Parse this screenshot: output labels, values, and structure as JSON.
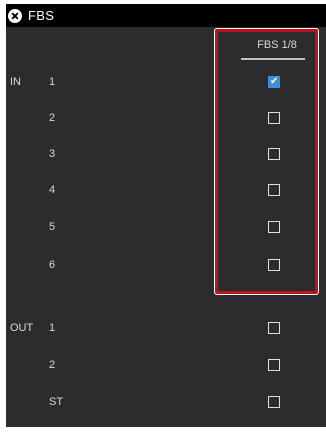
{
  "window": {
    "title": "FBS"
  },
  "column": {
    "header": "FBS 1/8"
  },
  "groups": {
    "in": "IN",
    "out": "OUT"
  },
  "rows": [
    {
      "group": "in",
      "label": "1",
      "checked": true
    },
    {
      "group": "in",
      "label": "2",
      "checked": false
    },
    {
      "group": "in",
      "label": "3",
      "checked": false
    },
    {
      "group": "in",
      "label": "4",
      "checked": false
    },
    {
      "group": "in",
      "label": "5",
      "checked": false
    },
    {
      "group": "in",
      "label": "6",
      "checked": false
    },
    {
      "group": "out",
      "label": "1",
      "checked": false
    },
    {
      "group": "out",
      "label": "2",
      "checked": false
    },
    {
      "group": "out",
      "label": "ST",
      "checked": false
    }
  ],
  "icons": {
    "close": "close-icon",
    "check": "checkmark-icon"
  },
  "colors": {
    "checked": "#3c8fd8",
    "highlight": "#c0121c",
    "background": "#2c2c2f"
  }
}
